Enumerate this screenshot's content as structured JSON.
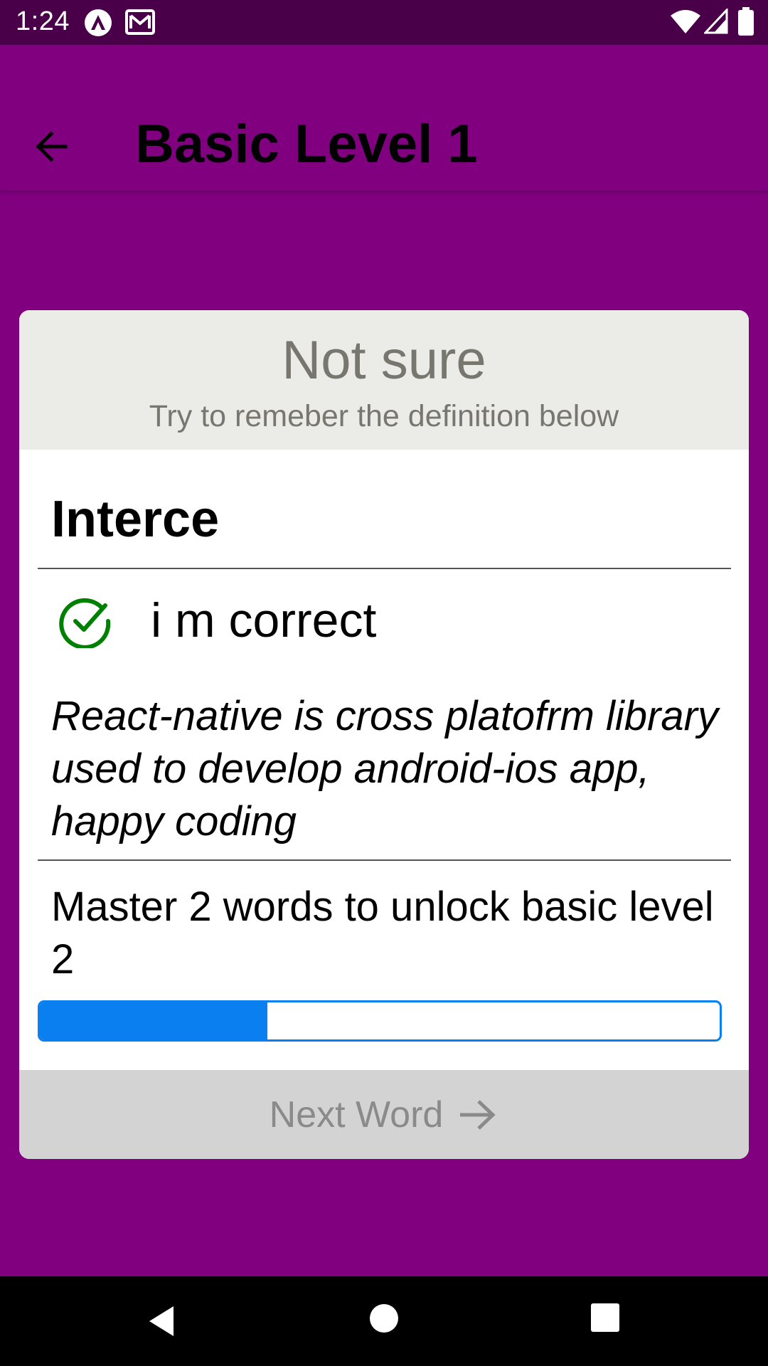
{
  "status_bar": {
    "time": "1:24",
    "icons": [
      "app-notification-icon",
      "gmail-icon",
      "wifi-icon",
      "cell-signal-icon",
      "battery-icon"
    ]
  },
  "header": {
    "title": "Basic Level 1",
    "back_icon": "arrow-left-icon"
  },
  "card": {
    "status_label": "Not sure",
    "status_hint": "Try to remeber the definition below",
    "word": "Interce",
    "answer": {
      "icon": "check-circle-icon",
      "text": "i m correct",
      "icon_color": "#008000"
    },
    "definition": "React-native is cross platofrm library used to develop android-ios app, happy coding",
    "unlock_text": "Master 2 words to unlock basic level 2",
    "progress": 0.335,
    "next_button": {
      "label": "Next Word",
      "icon": "arrow-right-icon"
    }
  },
  "colors": {
    "background": "#800080",
    "status_bar": "#4a0049",
    "card_header": "#ebebe8",
    "progress": "#0a7ff0",
    "next_button": "#d3d3d3"
  },
  "nav_bar": {
    "buttons": [
      "back-triangle-icon",
      "home-circle-icon",
      "recents-square-icon"
    ]
  }
}
